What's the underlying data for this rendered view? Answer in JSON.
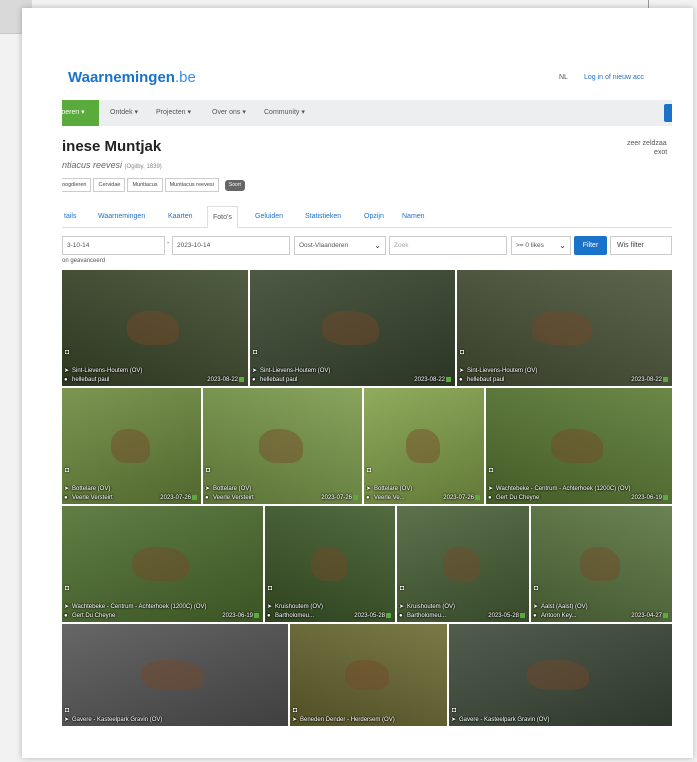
{
  "header": {
    "logo_text": "Waarnemingen",
    "logo_tld": ".be",
    "lang": "NL",
    "login": "Log in of nieuw acc"
  },
  "nav": {
    "items": [
      "Invoeren ▾",
      "Ontdek ▾",
      "Projecten ▾",
      "Over ons ▾",
      "Community ▾"
    ]
  },
  "species": {
    "title": "inese Muntjak",
    "scientific": "ntiacus reevesi",
    "author": "(Ogilby, 1839)",
    "rarity_line1": "zeer zeldzaa",
    "rarity_line2": "exot"
  },
  "breadcrumbs": [
    "oogdieren",
    "Cervidae",
    "Muntiacus",
    "Muntiacus reevesi"
  ],
  "breadcrumb_badge": "Soort",
  "tabs": [
    "tails",
    "Waarnemingen",
    "Kaarten",
    "Foto's",
    "Geluiden",
    "Statistieken",
    "Opzijn",
    "Namen"
  ],
  "filters": {
    "date_from": "3-10-14",
    "date_to": "2023-10-14",
    "region": "Oost-Vlaanderen",
    "search_placeholder": "Zoek",
    "likes": ">= 0 likes",
    "filter_button": "Filter",
    "clear_button": "Wis filter",
    "advanced": "on geavanceerd"
  },
  "photos": [
    {
      "location": "Sint-Lievens-Houtem (OV)",
      "user": "hellebaut paul",
      "date": "2023-08-22",
      "bg": "#3d4a2c"
    },
    {
      "location": "Sint-Lievens-Houtem (OV)",
      "user": "hellebaut paul",
      "date": "2023-08-22",
      "bg": "#3a4730"
    },
    {
      "location": "Sint-Lievens-Houtem (OV)",
      "user": "hellebaut paul",
      "date": "2023-08-22",
      "bg": "#4a5438"
    },
    {
      "location": "Bottelare (OV)",
      "user": "Veerle Versteirt",
      "date": "2023-07-26",
      "bg": "#6d8a3e"
    },
    {
      "location": "Bottelare (OV)",
      "user": "Veerle Versteirt",
      "date": "2023-07-26",
      "bg": "#7a9a4a"
    },
    {
      "location": "Bottelare (OV)",
      "user": "Veerle Ve...",
      "date": "2023-07-26",
      "bg": "#83a24a"
    },
    {
      "location": "Wachtebeke - Centrum - Achterhoek (1200C) (OV)",
      "user": "Gert Du Cheyne",
      "date": "2023-06-19",
      "bg": "#5a7a33"
    },
    {
      "location": "Wachtebeke - Centrum - Achterhoek (1200C) (OV)",
      "user": "Gert Du Cheyne",
      "date": "2023-06-19",
      "bg": "#4f7030"
    },
    {
      "location": "Kruishoutem (OV)",
      "user": "Bartholomeu...",
      "date": "2023-05-28",
      "bg": "#3e5a2a"
    },
    {
      "location": "Kruishoutem (OV)",
      "user": "Bartholomeu...",
      "date": "2023-05-28",
      "bg": "#4a6238"
    },
    {
      "location": "Aalst (Aalst) (OV)",
      "user": "Antoon Key...",
      "date": "2023-04-27",
      "bg": "#5a7540"
    },
    {
      "location": "Gavere - Kasteelpark Gravin (OV)",
      "user": "",
      "date": "",
      "bg": "#555555"
    },
    {
      "location": "Beneden Dender - Herdersem (OV)",
      "user": "",
      "date": "",
      "bg": "#6b6a32"
    },
    {
      "location": "Gavere - Kasteelpark Gravin (OV)",
      "user": "",
      "date": "",
      "bg": "#3e4a3a"
    }
  ],
  "colors": {
    "brand_blue": "#1a73c8",
    "nav_active": "#5aab3c"
  }
}
